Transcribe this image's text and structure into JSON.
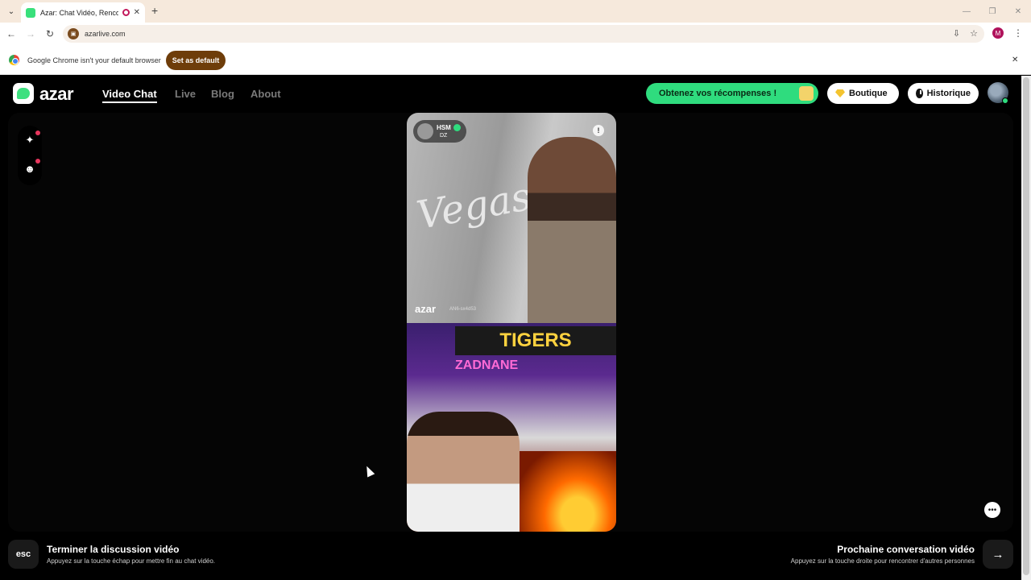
{
  "browser": {
    "tab_title": "Azar: Chat Vidéo, Rencontr",
    "url": "azarlive.com",
    "profile_initial": "M",
    "infobar_text": "Google Chrome isn't your default browser",
    "set_default_label": "Set as default"
  },
  "site": {
    "logo_text": "azar",
    "nav": [
      "Video Chat",
      "Live",
      "Blog",
      "About"
    ],
    "rewards_label": "Obtenez vos récompenses !",
    "shop_label": "Boutique",
    "history_label": "Historique"
  },
  "partner": {
    "name": "HSM",
    "country": "DZ",
    "watermark": "azar",
    "watermark_id": "AN6-sx4d53"
  },
  "video_scene": {
    "wall_text": "Vegas",
    "banner_text": "TIGERS",
    "neon_text": "ZADNANE"
  },
  "footer": {
    "esc_key": "esc",
    "end_title": "Terminer la discussion vidéo",
    "end_sub": "Appuyez sur la touche échap pour mettre fin au chat vidéo.",
    "next_title": "Prochaine conversation vidéo",
    "next_sub": "Appuyez sur la touche droite pour rencontrer d'autres personnes"
  },
  "colors": {
    "accent_green": "#2fdc7e",
    "set_default_bg": "#6e3d0a",
    "notification_dot": "#e8365d"
  }
}
